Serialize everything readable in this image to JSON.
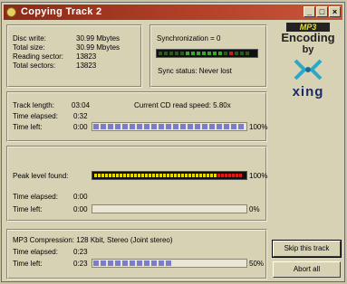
{
  "window": {
    "title": "Copying Track 2",
    "buttons": {
      "minimize": "_",
      "maximize": "□",
      "close": "×"
    }
  },
  "disc": {
    "disc_write_label": "Disc write:",
    "disc_write_value": "30.99 Mbytes",
    "total_size_label": "Total size:",
    "total_size_value": "30.99 Mbytes",
    "reading_sector_label": "Reading sector:",
    "reading_sector_value": "13823",
    "total_sectors_label": "Total sectors:",
    "total_sectors_value": "13823"
  },
  "sync": {
    "label": "Synchronization = 0",
    "status": "Sync status: Never lost"
  },
  "logo": {
    "mp3": "MP3",
    "encoding": "Encoding",
    "by": "by",
    "brand": "xing"
  },
  "track": {
    "length_label": "Track length:",
    "length_value": "03:04",
    "speed_label": "Current CD read speed: 5.80x",
    "elapsed_label": "Time elapsed:",
    "elapsed_value": "0:32",
    "left_label": "Time left:",
    "left_value": "0:00",
    "percent": "100%",
    "progress": 1.0
  },
  "peak": {
    "label": "Peak level found:",
    "percent": "100%",
    "elapsed_label": "Time elapsed:",
    "elapsed_value": "0:00",
    "left_label": "Time left:",
    "left_value": "0:00",
    "percent2": "0%",
    "level": 1.0,
    "progress": 0.0
  },
  "mp3": {
    "compression": "MP3 Compression: 128 Kbit, Stereo (Joint stereo)",
    "elapsed_label": "Time elapsed:",
    "elapsed_value": "0:23",
    "left_label": "Time left:",
    "left_value": "0:23",
    "percent": "50%",
    "progress": 0.5
  },
  "actions": {
    "skip": "Skip this track",
    "abort": "Abort all"
  },
  "colors": {
    "title_bar": "#a03520",
    "progress": "#7a7ec8",
    "meter_yellow": "#e8d800",
    "meter_red": "#e01818"
  }
}
